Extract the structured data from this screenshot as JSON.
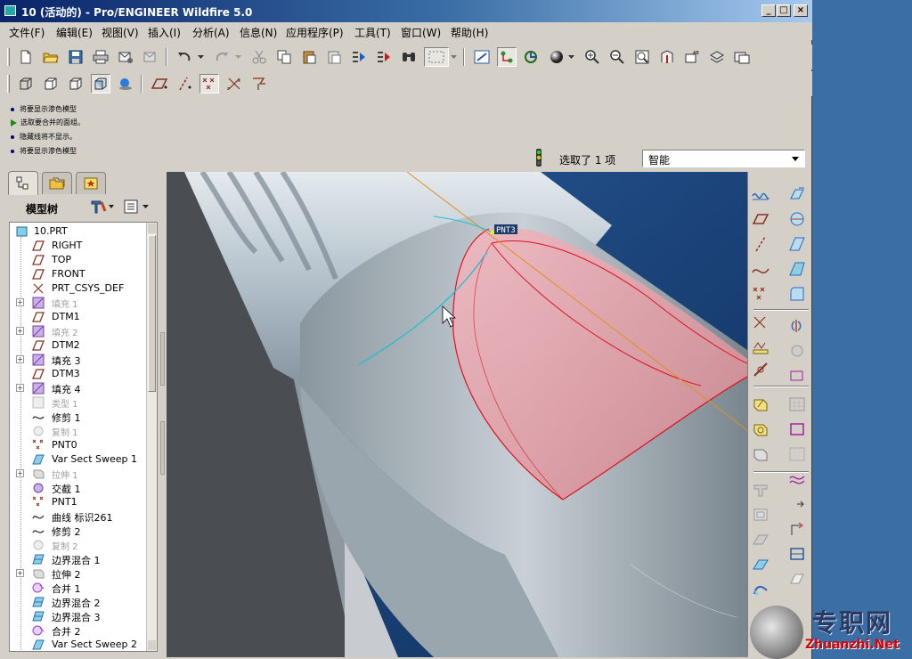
{
  "window": {
    "title": "10 (活动的) - Pro/ENGINEER Wildfire 5.0"
  },
  "menubar": [
    "文件(F)",
    "编辑(E)",
    "视图(V)",
    "插入(I)",
    "分析(A)",
    "信息(N)",
    "应用程序(P)",
    "工具(T)",
    "窗口(W)",
    "帮助(H)"
  ],
  "messages": [
    {
      "text": "将要显示渗色模型",
      "kind": "info"
    },
    {
      "text": "选取要合并的面组。",
      "kind": "prompt"
    },
    {
      "text": "隐藏线将不显示。",
      "kind": "info"
    },
    {
      "text": "将要显示渗色模型",
      "kind": "info"
    }
  ],
  "status": {
    "selection_text": "选取了 1 项",
    "filter_value": "智能"
  },
  "model_tree": {
    "title": "模型树",
    "items": [
      {
        "label": "10.PRT",
        "icon": "part-icon",
        "expandable": false,
        "dim": false
      },
      {
        "label": "RIGHT",
        "icon": "datum-plane-icon",
        "expandable": false,
        "dim": false
      },
      {
        "label": "TOP",
        "icon": "datum-plane-icon",
        "expandable": false,
        "dim": false
      },
      {
        "label": "FRONT",
        "icon": "datum-plane-icon",
        "expandable": false,
        "dim": false
      },
      {
        "label": "PRT_CSYS_DEF",
        "icon": "csys-icon",
        "expandable": false,
        "dim": false
      },
      {
        "label": "填充 1",
        "icon": "fill-icon",
        "expandable": true,
        "dim": true
      },
      {
        "label": "DTM1",
        "icon": "datum-plane-icon",
        "expandable": false,
        "dim": false
      },
      {
        "label": "填充 2",
        "icon": "fill-icon",
        "expandable": true,
        "dim": true
      },
      {
        "label": "DTM2",
        "icon": "datum-plane-icon",
        "expandable": false,
        "dim": false
      },
      {
        "label": "填充 3",
        "icon": "fill-icon",
        "expandable": true,
        "dim": false
      },
      {
        "label": "DTM3",
        "icon": "datum-plane-icon",
        "expandable": false,
        "dim": false
      },
      {
        "label": "填充 4",
        "icon": "fill-icon",
        "expandable": true,
        "dim": false
      },
      {
        "label": "类型 1",
        "icon": "type-icon",
        "expandable": false,
        "dim": true
      },
      {
        "label": "修剪 1",
        "icon": "trim-icon",
        "expandable": false,
        "dim": false
      },
      {
        "label": "复制 1",
        "icon": "copy-icon",
        "expandable": false,
        "dim": true
      },
      {
        "label": "PNT0",
        "icon": "datum-point-icon",
        "expandable": false,
        "dim": false
      },
      {
        "label": "Var Sect Sweep 1",
        "icon": "sweep-icon",
        "expandable": false,
        "dim": false
      },
      {
        "label": "拉伸 1",
        "icon": "extrude-icon",
        "expandable": true,
        "dim": true
      },
      {
        "label": "交截 1",
        "icon": "intersect-icon",
        "expandable": false,
        "dim": false
      },
      {
        "label": "PNT1",
        "icon": "datum-point-icon",
        "expandable": false,
        "dim": false
      },
      {
        "label": "曲线 标识261",
        "icon": "curve-icon",
        "expandable": false,
        "dim": false
      },
      {
        "label": "修剪 2",
        "icon": "trim-icon",
        "expandable": false,
        "dim": false
      },
      {
        "label": "复制 2",
        "icon": "copy-icon",
        "expandable": false,
        "dim": true
      },
      {
        "label": "边界混合 1",
        "icon": "boundary-blend-icon",
        "expandable": false,
        "dim": false
      },
      {
        "label": "拉伸 2",
        "icon": "extrude-icon",
        "expandable": true,
        "dim": false
      },
      {
        "label": "合并 1",
        "icon": "merge-icon",
        "expandable": false,
        "dim": false
      },
      {
        "label": "边界混合 2",
        "icon": "boundary-blend-icon",
        "expandable": false,
        "dim": false
      },
      {
        "label": "边界混合 3",
        "icon": "boundary-blend-icon",
        "expandable": false,
        "dim": false
      },
      {
        "label": "合并 2",
        "icon": "merge-icon",
        "expandable": false,
        "dim": false
      },
      {
        "label": "Var Sect Sweep 2",
        "icon": "sweep-icon",
        "expandable": false,
        "dim": false
      }
    ]
  },
  "viewport": {
    "point_label": "PNT3",
    "highlight_color": "#e8a0a8",
    "edge_color": "#e01020"
  },
  "watermark": {
    "cn": "专职网",
    "en": "Zhuanzhi.Net"
  }
}
